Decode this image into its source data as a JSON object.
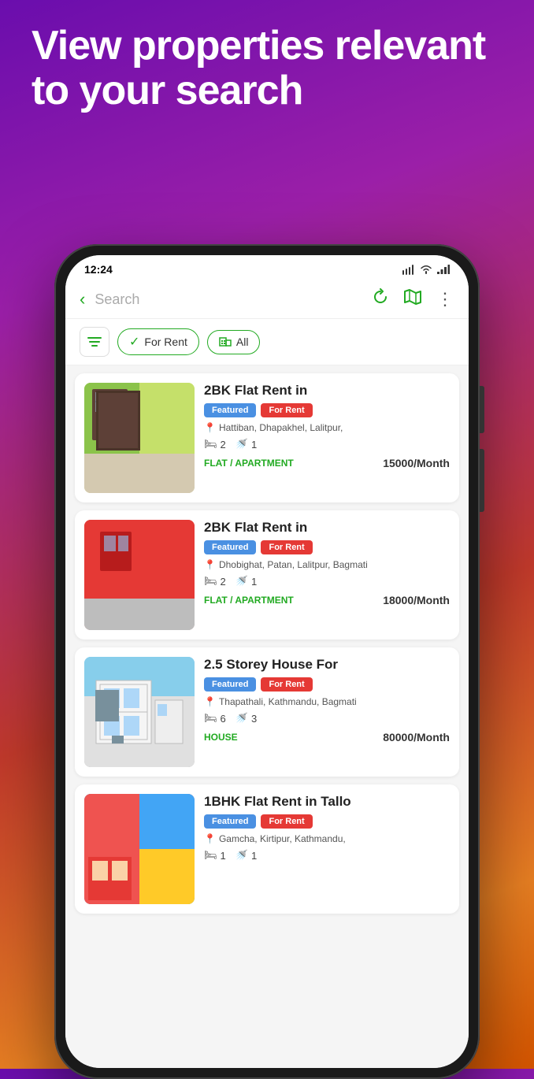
{
  "hero": {
    "title": "View properties relevant to your search"
  },
  "status_bar": {
    "time": "12:24",
    "icons": [
      "phone-icon",
      "wifi-icon",
      "signal-icon",
      "battery-icon"
    ]
  },
  "header": {
    "back_label": "‹",
    "search_placeholder": "Search",
    "refresh_icon": "refresh-icon",
    "map_icon": "map-icon",
    "more_icon": "more-icon"
  },
  "filters": {
    "filter_icon": "filter-icon",
    "chips": [
      {
        "label": "For Rent",
        "has_check": true
      },
      {
        "label": "All",
        "has_building": true
      }
    ]
  },
  "listings": [
    {
      "id": 1,
      "title": "2BK Flat Rent in",
      "badges": [
        "Featured",
        "For Rent"
      ],
      "location": "Hattiban, Dhapakhel, Lalitpur,",
      "bedrooms": "2",
      "bathrooms": "1",
      "property_type": "FLAT / APARTMENT",
      "price": "15000/Month",
      "image_class": "img-1"
    },
    {
      "id": 2,
      "title": "2BK Flat Rent in",
      "badges": [
        "Featured",
        "For Rent"
      ],
      "location": "Dhobighat, Patan, Lalitpur, Bagmati",
      "bedrooms": "2",
      "bathrooms": "1",
      "property_type": "FLAT / APARTMENT",
      "price": "18000/Month",
      "image_class": "img-2"
    },
    {
      "id": 3,
      "title": "2.5 Storey House For",
      "badges": [
        "Featured",
        "For Rent"
      ],
      "location": "Thapathali, Kathmandu, Bagmati",
      "bedrooms": "6",
      "bathrooms": "3",
      "property_type": "HOUSE",
      "price": "80000/Month",
      "image_class": "img-3"
    },
    {
      "id": 4,
      "title": "1BHK Flat Rent in Tallo",
      "badges": [
        "Featured",
        "For Rent"
      ],
      "location": "Gamcha, Kirtipur, Kathmandu,",
      "bedrooms": "1",
      "bathrooms": "1",
      "property_type": "",
      "price": "",
      "image_class": "img-4"
    }
  ],
  "colors": {
    "green": "#22aa22",
    "blue_badge": "#4a90e2",
    "red_badge": "#e53935",
    "purple_hero": "#6a0dad"
  }
}
